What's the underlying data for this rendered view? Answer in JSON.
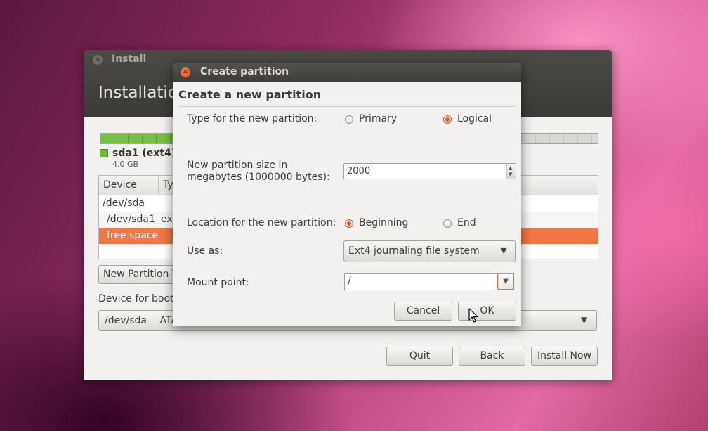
{
  "main": {
    "window_title": "Install",
    "heading": "Installatio",
    "legend": {
      "name": "sda1 (ext4)",
      "size": "4.0 GB",
      "color": "#69bb39"
    },
    "table": {
      "headers": [
        "Device",
        "Ty"
      ],
      "rows": [
        {
          "device": "/dev/sda",
          "type": ""
        },
        {
          "device": "/dev/sda1",
          "type": "ex"
        },
        {
          "device": "free space",
          "type": ""
        }
      ]
    },
    "new_partition_label": "New Partition T",
    "boot_label": "Device for boot",
    "boot_combo": {
      "device": "/dev/sda",
      "rest": "ATA"
    },
    "buttons": {
      "quit": "Quit",
      "back": "Back",
      "install": "Install Now"
    }
  },
  "dialog": {
    "title": "Create partition",
    "heading": "Create a new partition",
    "type": {
      "label": "Type for the new partition:",
      "options": [
        "Primary",
        "Logical"
      ],
      "selected": "Logical"
    },
    "size": {
      "label_line1": "New partition size in",
      "label_line2": "megabytes (1000000 bytes):",
      "value": "2000"
    },
    "location": {
      "label": "Location for the new partition:",
      "options": [
        "Beginning",
        "End"
      ],
      "selected": "Beginning"
    },
    "use_as": {
      "label": "Use as:",
      "value": "Ext4 journaling file system"
    },
    "mount_point": {
      "label": "Mount point:",
      "value": "/"
    },
    "buttons": {
      "cancel": "Cancel",
      "ok": "OK"
    }
  },
  "colors": {
    "accent": "#f07746",
    "radio_selected": "#e2571f"
  }
}
